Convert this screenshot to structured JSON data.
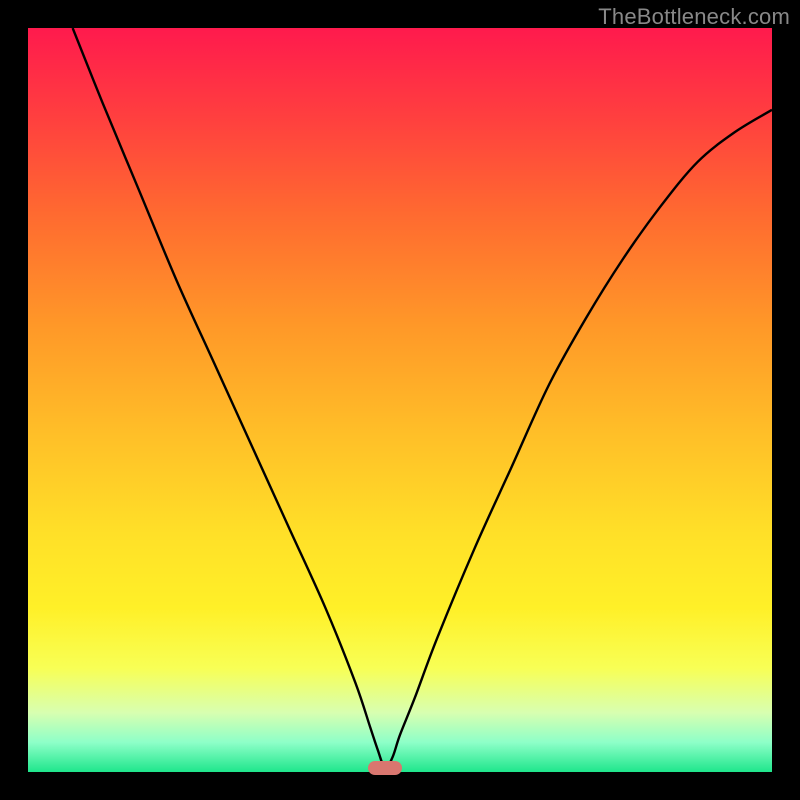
{
  "watermark": "TheBottleneck.com",
  "colors": {
    "background": "#000000",
    "curve_stroke": "#000000",
    "marker_fill": "#d9766f",
    "watermark_text": "#888888"
  },
  "chart_data": {
    "type": "line",
    "title": "",
    "xlabel": "",
    "ylabel": "",
    "xlim": [
      0,
      100
    ],
    "ylim": [
      0,
      100
    ],
    "grid": false,
    "legend": false,
    "series": [
      {
        "name": "bottleneck-curve",
        "notch_x": 48,
        "x": [
          6,
          10,
          15,
          20,
          25,
          30,
          35,
          40,
          44,
          46,
          47,
          48,
          49,
          50,
          52,
          55,
          60,
          65,
          70,
          75,
          80,
          85,
          90,
          95,
          100
        ],
        "y": [
          100,
          90,
          78,
          66,
          55,
          44,
          33,
          22,
          12,
          6,
          3,
          0.5,
          2,
          5,
          10,
          18,
          30,
          41,
          52,
          61,
          69,
          76,
          82,
          86,
          89
        ]
      }
    ],
    "marker": {
      "x": 48,
      "y": 0.5,
      "shape": "pill"
    },
    "gradient_stops": [
      {
        "pos": 0.0,
        "color": "#ff1a4d"
      },
      {
        "pos": 0.12,
        "color": "#ff3f3f"
      },
      {
        "pos": 0.25,
        "color": "#ff6a30"
      },
      {
        "pos": 0.4,
        "color": "#ff9828"
      },
      {
        "pos": 0.55,
        "color": "#ffc028"
      },
      {
        "pos": 0.68,
        "color": "#ffe028"
      },
      {
        "pos": 0.78,
        "color": "#fff028"
      },
      {
        "pos": 0.86,
        "color": "#f8ff55"
      },
      {
        "pos": 0.92,
        "color": "#d8ffb0"
      },
      {
        "pos": 0.96,
        "color": "#8effc8"
      },
      {
        "pos": 1.0,
        "color": "#1fe68c"
      }
    ]
  }
}
